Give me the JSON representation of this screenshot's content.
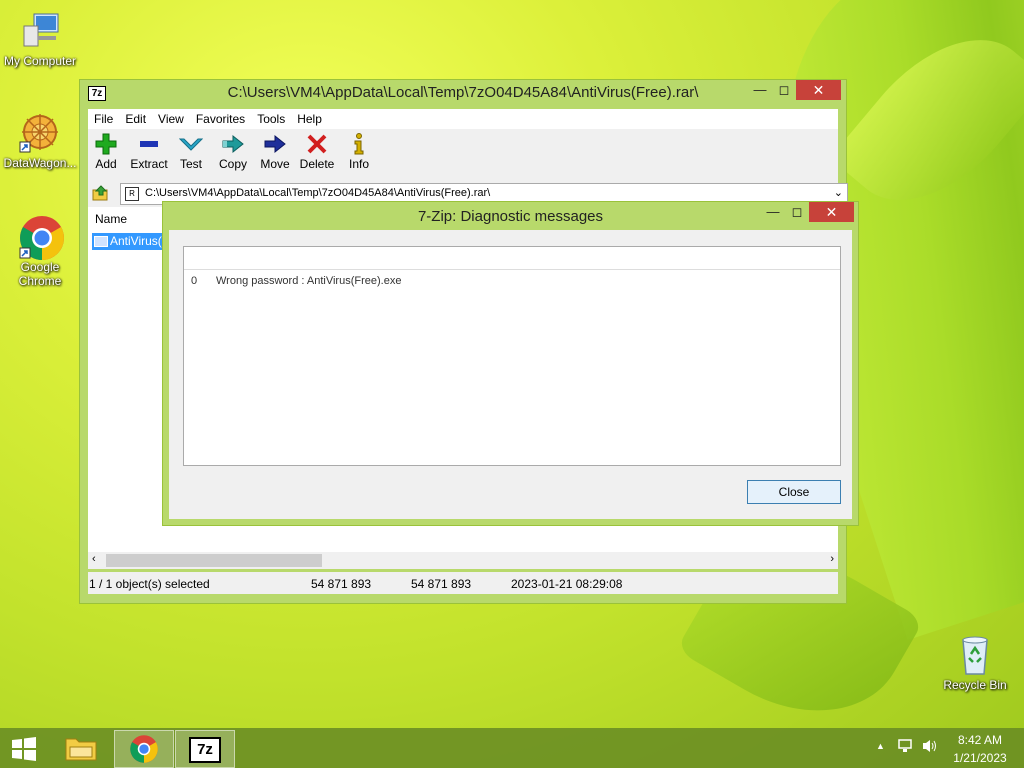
{
  "desktop": {
    "icons": [
      {
        "label": "My Computer"
      },
      {
        "label": "DataWagon..."
      },
      {
        "label": "Google Chrome"
      },
      {
        "label": "Recycle Bin"
      }
    ]
  },
  "main_window": {
    "app_icon": "7z",
    "title": "C:\\Users\\VM4\\AppData\\Local\\Temp\\7zO04D45A84\\AntiVirus(Free).rar\\",
    "menu": [
      "File",
      "Edit",
      "View",
      "Favorites",
      "Tools",
      "Help"
    ],
    "toolbar": [
      {
        "label": "Add",
        "icon": "plus-icon",
        "color": "#1faa1f"
      },
      {
        "label": "Extract",
        "icon": "minus-icon",
        "color": "#1f35b5"
      },
      {
        "label": "Test",
        "icon": "check-arrow-icon",
        "color": "#2aa7c9"
      },
      {
        "label": "Copy",
        "icon": "double-arrow-icon",
        "color": "#1f9a9a"
      },
      {
        "label": "Move",
        "icon": "arrow-right-icon",
        "color": "#1f2f9a"
      },
      {
        "label": "Delete",
        "icon": "x-icon",
        "color": "#d11f1f"
      },
      {
        "label": "Info",
        "icon": "info-icon",
        "color": "#d4b000"
      }
    ],
    "address": "C:\\Users\\VM4\\AppData\\Local\\Temp\\7zO04D45A84\\AntiVirus(Free).rar\\",
    "column_name": "Name",
    "selected_file": "AntiVirus(",
    "status": {
      "selected": "1 / 1 object(s) selected",
      "size": "54 871 893",
      "packed": "54 871 893",
      "modified": "2023-01-21 08:29:08"
    }
  },
  "dialog": {
    "title": "7-Zip: Diagnostic messages",
    "messages": [
      {
        "index": "0",
        "text": "Wrong password : AntiVirus(Free).exe"
      }
    ],
    "close_label": "Close"
  },
  "taskbar": {
    "time": "8:42 AM",
    "date": "1/21/2023",
    "app_7z": "7z"
  },
  "colors": {
    "accent": "#b8d96b",
    "close_red": "#c7423a",
    "selection": "#3399ff"
  }
}
